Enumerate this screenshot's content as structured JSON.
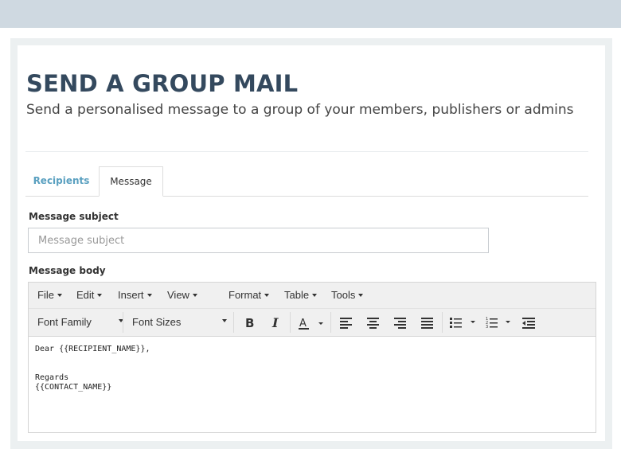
{
  "header": {
    "title": "SEND A GROUP MAIL",
    "subtitle": "Send a personalised message to a group of your members, publishers or admins"
  },
  "tabs": [
    {
      "label": "Recipients",
      "active": false
    },
    {
      "label": "Message",
      "active": true
    }
  ],
  "form": {
    "subject_label": "Message subject",
    "subject_placeholder": "Message subject",
    "subject_value": "",
    "body_label": "Message body"
  },
  "editor": {
    "menus": [
      "File",
      "Edit",
      "Insert",
      "View",
      "Format",
      "Table",
      "Tools"
    ],
    "font_family_label": "Font Family",
    "font_sizes_label": "Font Sizes",
    "toolbar_icons": [
      "bold-icon",
      "italic-icon",
      "text-color-icon",
      "align-left-icon",
      "align-center-icon",
      "align-right-icon",
      "align-justify-icon",
      "bullet-list-icon",
      "numbered-list-icon",
      "outdent-icon"
    ],
    "body_lines": [
      "Dear {{RECIPIENT_NAME}},",
      "",
      "",
      "Regards",
      "{{CONTACT_NAME}}"
    ]
  },
  "colors": {
    "title": "#34495e",
    "tab_link": "#5aa0c0",
    "topbar": "#cfd9e1",
    "frame": "#ecf0f1"
  }
}
